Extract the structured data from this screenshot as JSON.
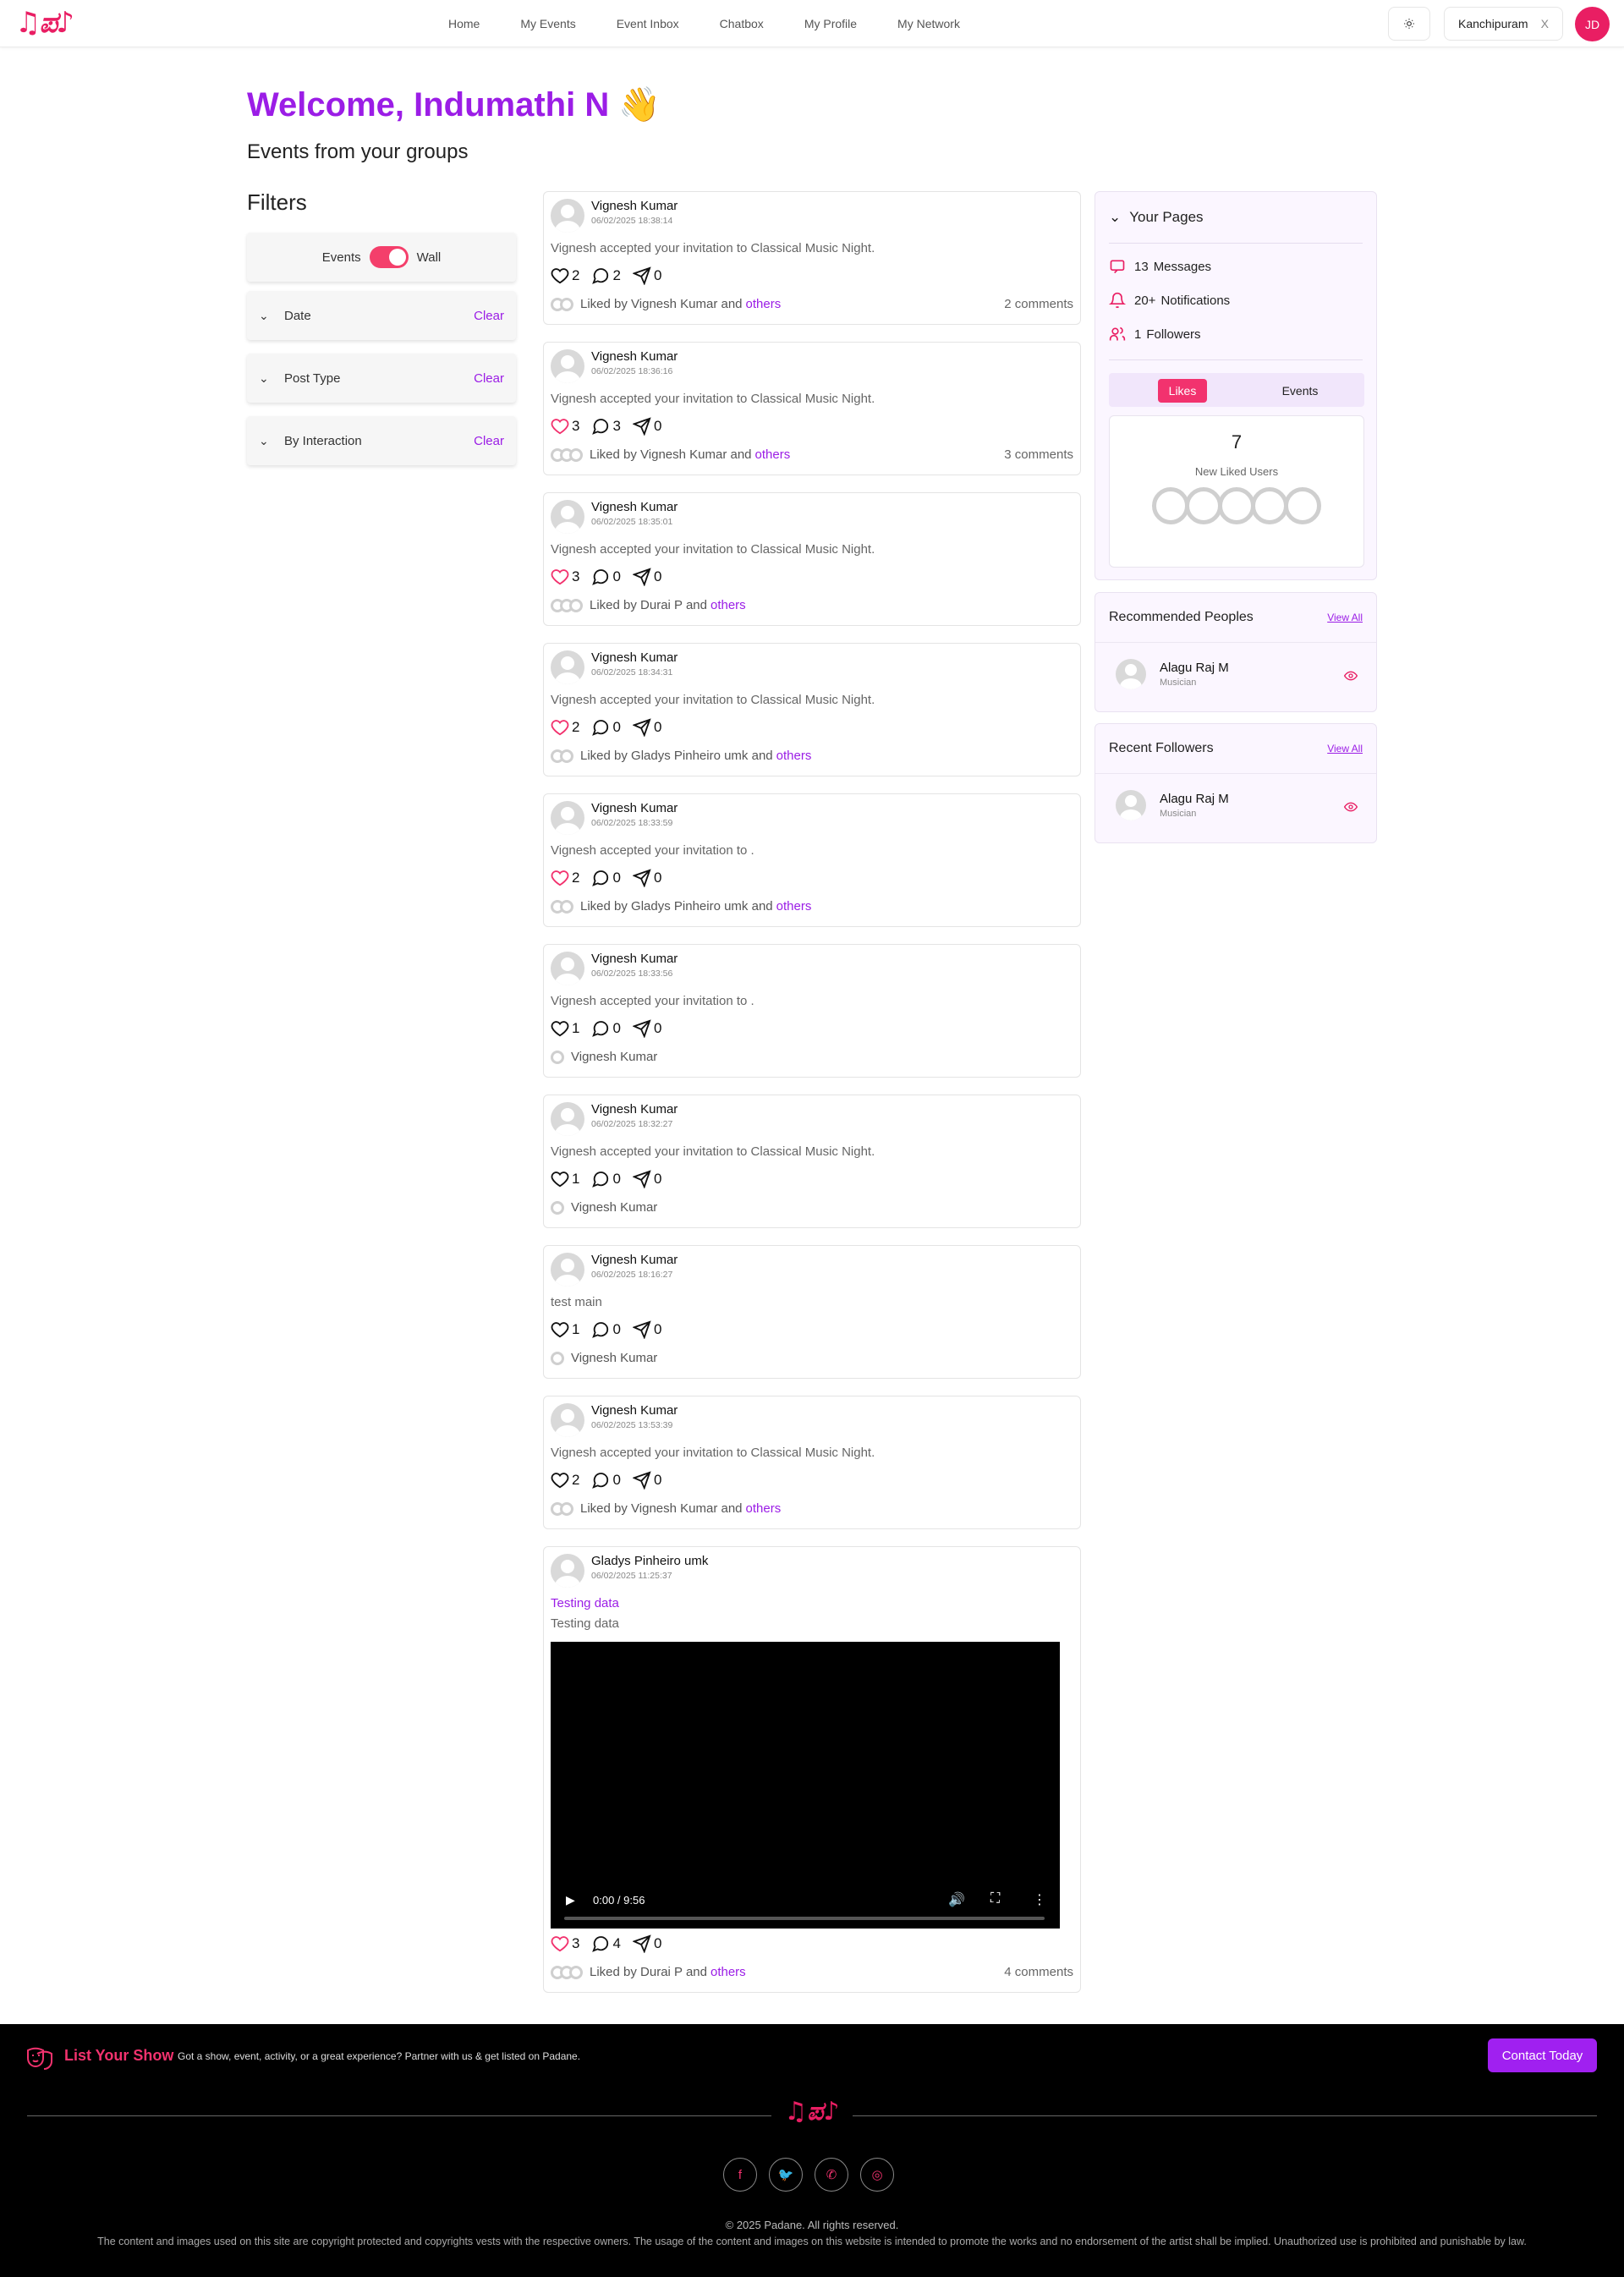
{
  "header": {
    "nav": [
      "Home",
      "My Events",
      "Event Inbox",
      "Chatbox",
      "My Profile",
      "My Network"
    ],
    "location": "Kanchipuram",
    "location_clear": "X",
    "avatar_initials": "JD",
    "theme_icon": "sun-icon"
  },
  "welcome": "Welcome, Indumathi N 👋",
  "subtitle": "Events from your groups",
  "filters": {
    "title": "Filters",
    "toggle_left": "Events",
    "toggle_right": "Wall",
    "sections": [
      {
        "label": "Date",
        "clear": "Clear"
      },
      {
        "label": "Post Type",
        "clear": "Clear"
      },
      {
        "label": "By Interaction",
        "clear": "Clear"
      }
    ]
  },
  "posts": [
    {
      "name": "Vignesh Kumar",
      "time": "06/02/2025 18:38:14",
      "text": "Vignesh accepted your invitation to Classical Music Night.",
      "likes": "2",
      "comments": "2",
      "shares": "0",
      "liked_by": "Liked by Vignesh Kumar and",
      "others": "others",
      "comment_count": "2 comments",
      "liked": false
    },
    {
      "name": "Vignesh Kumar",
      "time": "06/02/2025 18:36:16",
      "text": "Vignesh accepted your invitation to Classical Music Night.",
      "likes": "3",
      "comments": "3",
      "shares": "0",
      "liked_by": "Liked by Vignesh Kumar and",
      "others": "others",
      "comment_count": "3 comments",
      "liked": true
    },
    {
      "name": "Vignesh Kumar",
      "time": "06/02/2025 18:35:01",
      "text": "Vignesh accepted your invitation to Classical Music Night.",
      "likes": "3",
      "comments": "0",
      "shares": "0",
      "liked_by": "Liked by Durai P and",
      "others": "others",
      "comment_count": "",
      "liked": true
    },
    {
      "name": "Vignesh Kumar",
      "time": "06/02/2025 18:34:31",
      "text": "Vignesh accepted your invitation to Classical Music Night.",
      "likes": "2",
      "comments": "0",
      "shares": "0",
      "liked_by": "Liked by Gladys Pinheiro umk and",
      "others": "others",
      "comment_count": "",
      "liked": true
    },
    {
      "name": "Vignesh Kumar",
      "time": "06/02/2025 18:33:59",
      "text": "Vignesh accepted your invitation to .",
      "likes": "2",
      "comments": "0",
      "shares": "0",
      "liked_by": "Liked by Gladys Pinheiro umk and",
      "others": "others",
      "comment_count": "",
      "liked": true
    },
    {
      "name": "Vignesh Kumar",
      "time": "06/02/2025 18:33:56",
      "text": "Vignesh accepted your invitation to .",
      "likes": "1",
      "comments": "0",
      "shares": "0",
      "liked_by": "Vignesh Kumar",
      "others": "",
      "comment_count": "",
      "liked": false
    },
    {
      "name": "Vignesh Kumar",
      "time": "06/02/2025 18:32:27",
      "text": "Vignesh accepted your invitation to Classical Music Night.",
      "likes": "1",
      "comments": "0",
      "shares": "0",
      "liked_by": "Vignesh Kumar",
      "others": "",
      "comment_count": "",
      "liked": false
    },
    {
      "name": "Vignesh Kumar",
      "time": "06/02/2025 18:16:27",
      "text": "test main",
      "likes": "1",
      "comments": "0",
      "shares": "0",
      "liked_by": "Vignesh Kumar",
      "others": "",
      "comment_count": "",
      "liked": false
    },
    {
      "name": "Vignesh Kumar",
      "time": "06/02/2025 13:53:39",
      "text": "Vignesh accepted your invitation to Classical Music Night.",
      "likes": "2",
      "comments": "0",
      "shares": "0",
      "liked_by": "Liked by Vignesh Kumar and",
      "others": "others",
      "comment_count": "",
      "liked": false
    }
  ],
  "video_post": {
    "name": "Gladys Pinheiro umk",
    "time": "06/02/2025 11:25:37",
    "title": "Testing data",
    "text": "Testing data",
    "video_time": "0:00 / 9:56",
    "likes": "3",
    "comments": "4",
    "shares": "0",
    "liked_by": "Liked by Durai P and",
    "others": "others",
    "comment_count": "4 comments"
  },
  "your_pages": {
    "title": "Your Pages",
    "messages_count": "13",
    "messages_label": "Messages",
    "notifications_count": "20+",
    "notifications_label": "Notifications",
    "followers_count": "1",
    "followers_label": "Followers",
    "tab_likes": "Likes",
    "tab_events": "Events",
    "liked_users_count": "7",
    "liked_users_label": "New Liked Users"
  },
  "recommended": {
    "title": "Recommended Peoples",
    "view_all": "View All",
    "name": "Alagu Raj M",
    "role": "Musician"
  },
  "recent_followers": {
    "title": "Recent Followers",
    "view_all": "View All",
    "name": "Alagu Raj M",
    "role": "Musician"
  },
  "footer": {
    "list_title": "List Your Show",
    "list_desc": "Got a show, event, activity, or a great experience? Partner with us & get listed on Padane.",
    "contact": "Contact Today",
    "copyright": "© 2025 Padane. All rights reserved.",
    "legal": "The content and images used on this site are copyright protected and copyrights vests with the respective owners. The usage of the content and images on this website is intended to promote the works and no endorsement of the artist shall be implied. Unauthorized use is prohibited and punishable by law."
  },
  "colors": {
    "accent": "#9b1de6",
    "brand_pink": "#f2326e",
    "footer_bg": "#000000"
  }
}
